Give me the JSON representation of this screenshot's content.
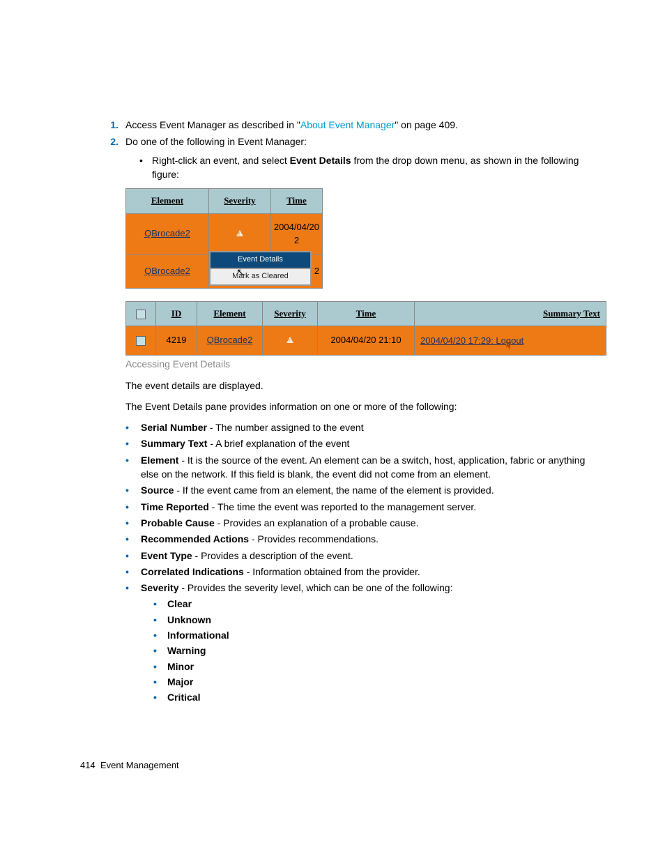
{
  "steps": {
    "s1": {
      "num": "1.",
      "pre": "Access Event Manager as described in \"",
      "link": "About Event Manager",
      "post": "\" on page 409."
    },
    "s2": {
      "num": "2.",
      "text": "Do one of the following in Event Manager:"
    },
    "s2sub": {
      "pre": "Right-click an event, and select ",
      "bold": "Event Details",
      "post": " from the drop down menu, as shown in the following figure:"
    }
  },
  "fig1": {
    "headers": {
      "element": "Element",
      "severity": "Severity",
      "time": "Time"
    },
    "rows": {
      "r1": {
        "element": "QBrocade2",
        "time": "2004/04/20 2"
      },
      "r2": {
        "element": "QBrocade2",
        "timetrail": "2"
      }
    },
    "menu": {
      "sel": "Event Details",
      "norm": "Mark as Cleared"
    }
  },
  "fig2": {
    "headers": {
      "cb": "",
      "id": "ID",
      "element": "Element",
      "severity": "Severity",
      "time": "Time",
      "summary": "Summary Text"
    },
    "row": {
      "id": "4219",
      "element": "QBrocade2",
      "time": "2004/04/20 21:10",
      "summary": "2004/04/20 17:29: Logout"
    }
  },
  "caption": "Accessing Event Details",
  "p1": "The event details are displayed.",
  "p2": "The Event Details pane provides information on one or more of the following:",
  "details": [
    {
      "b": "Serial Number",
      "t": " - The number assigned to the event"
    },
    {
      "b": "Summary Text",
      "t": " - A brief explanation of the event"
    },
    {
      "b": "Element",
      "t": " - It is the source of the event. An element can be a switch, host, application, fabric or anything else on the network. If this field is blank, the event did not come from an element."
    },
    {
      "b": "Source",
      "t": " - If the event came from an element, the name of the element is provided."
    },
    {
      "b": "Time Reported",
      "t": " - The time the event was reported to the management server."
    },
    {
      "b": "Probable Cause",
      "t": " - Provides an explanation of a probable cause."
    },
    {
      "b": "Recommended Actions",
      "t": " - Provides recommendations."
    },
    {
      "b": "Event Type",
      "t": " - Provides a description of the event."
    },
    {
      "b": "Correlated Indications",
      "t": " - Information obtained from the provider."
    },
    {
      "b": "Severity",
      "t": " - Provides the severity level, which can be one of the following:"
    }
  ],
  "severities": [
    "Clear",
    "Unknown",
    "Informational",
    "Warning",
    "Minor",
    "Major",
    "Critical"
  ],
  "footer": {
    "page": "414",
    "title": "Event Management"
  }
}
